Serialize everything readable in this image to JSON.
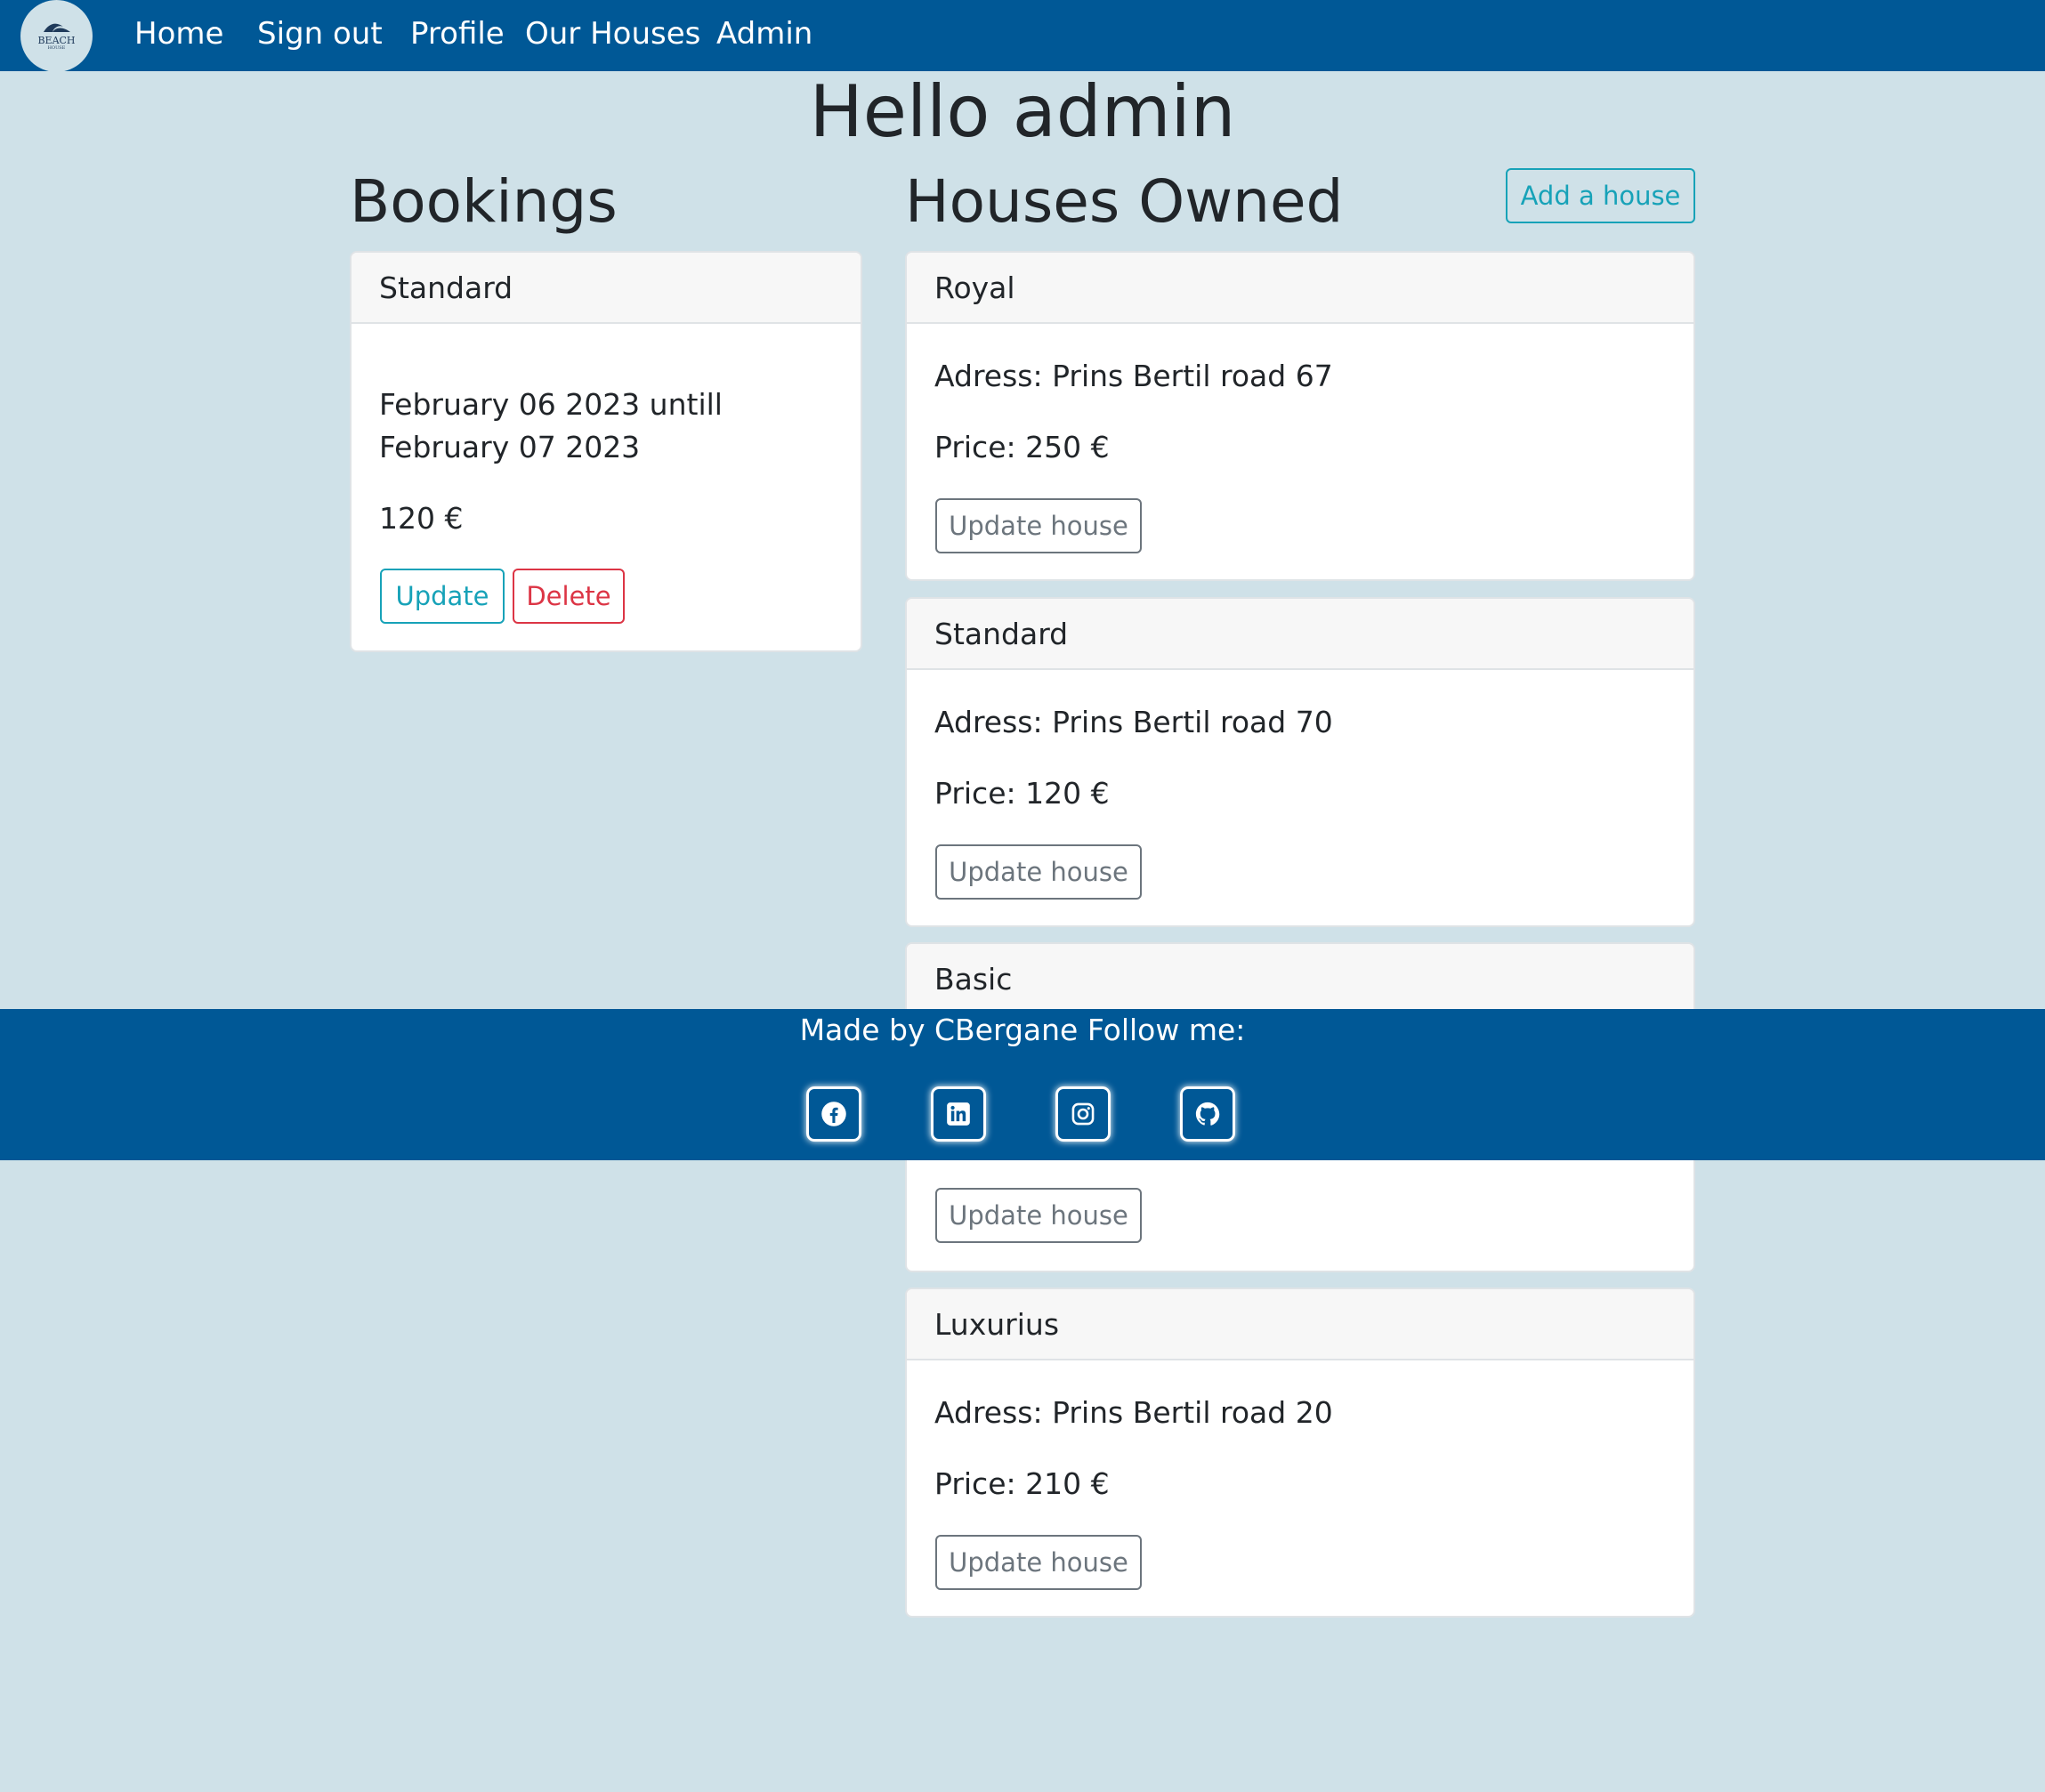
{
  "nav": {
    "logo": {
      "main_text": "BEACH",
      "sub_text": "HOUSE"
    },
    "links": [
      {
        "label": "Home"
      },
      {
        "label": "Sign out"
      },
      {
        "label": "Profile"
      },
      {
        "label": "Our Houses"
      },
      {
        "label": "Admin"
      }
    ]
  },
  "page": {
    "title": "Hello admin"
  },
  "bookings": {
    "heading": "Bookings",
    "items": [
      {
        "house": "Standard",
        "date_line1": "February 06 2023 untill",
        "date_line2": "February 07 2023",
        "price": "120 €",
        "update_label": "Update",
        "delete_label": "Delete"
      }
    ]
  },
  "houses": {
    "heading": "Houses Owned",
    "add_button": "Add a house",
    "items": [
      {
        "name": "Royal",
        "address": "Adress: Prins Bertil road 67",
        "price": "Price: 250 €",
        "button": "Update house"
      },
      {
        "name": "Standard",
        "address": "Adress: Prins Bertil road 70",
        "price": "Price: 120 €",
        "button": "Update house"
      },
      {
        "name": "Basic",
        "button": "Update house"
      },
      {
        "name": "Luxurius",
        "address": "Adress: Prins Bertil road 20",
        "price": "Price: 210 €",
        "button": "Update house"
      }
    ]
  },
  "footer": {
    "text": "Made by CBergane Follow me:",
    "social_icons": [
      "facebook-icon",
      "linkedin-icon",
      "instagram-icon",
      "github-icon"
    ]
  },
  "colors": {
    "navbar": "#005896",
    "background": "#cfe1e8",
    "info": "#17a2b8",
    "danger": "#dc3545",
    "secondary": "#6c757d"
  }
}
